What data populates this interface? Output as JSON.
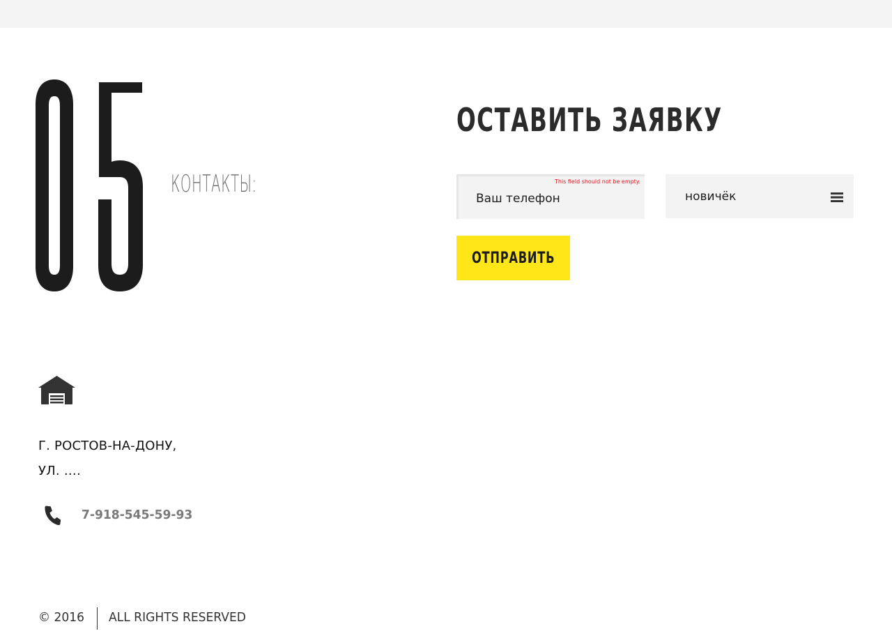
{
  "section": {
    "number": "05",
    "title": "КОНТАКТЫ:"
  },
  "form": {
    "title": "ОСТАВИТЬ ЗАЯВКУ",
    "phone_placeholder": "Ваш телефон",
    "phone_error": "This field should not be empty.",
    "level_value": "новичёк",
    "submit_label": "ОТПРАВИТЬ"
  },
  "contacts": {
    "address_line1": "Г. РОСТОВ-НА-ДОНУ,",
    "address_line2": "УЛ. ….",
    "phone": "7-918-545-59-93"
  },
  "footer": {
    "copyright": "© 2016",
    "rights": "ALL RIGHTS RESERVED"
  },
  "colors": {
    "accent": "#ffe619",
    "error": "#e0161b",
    "dark": "#1c1c1c",
    "input_bg": "#f3f3f3",
    "top_bar": "#f4f4f4"
  },
  "icons": {
    "address": "house-icon",
    "phone": "phone-icon",
    "select": "menu-icon"
  }
}
